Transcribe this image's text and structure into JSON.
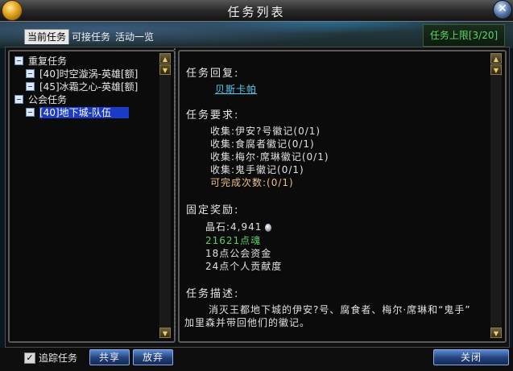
{
  "window": {
    "title": "任务列表",
    "close_glyph": "✕"
  },
  "tabs": [
    {
      "label": "当前任务",
      "active": true
    },
    {
      "label": "可接任务",
      "active": false
    },
    {
      "label": "活动一览",
      "active": false
    }
  ],
  "limit_badge": "任务上限[3/20]",
  "tree": {
    "categories": [
      {
        "label": "重复任务",
        "items": [
          "[40]时空漩涡-英雄[额]",
          "[45]冰霜之心-英雄[额]"
        ]
      },
      {
        "label": "公会任务",
        "items": [
          "[40]地下城-队伍"
        ]
      }
    ],
    "selected": "[40]地下城-队伍"
  },
  "detail": {
    "reply_header": "任务回复:",
    "reply_npc": "贝斯卡帕",
    "req_header": "任务要求:",
    "requirements": [
      "收集:伊安?号徽记(0/1)",
      "收集:食腐者徽记(0/1)",
      "收集:梅尔·席琳徽记(0/1)",
      "收集:鬼手徽记(0/1)"
    ],
    "completions": "可完成次数:(0/1)",
    "reward_header": "固定奖励:",
    "rewards": {
      "crystal": "晶石:4,941",
      "soul": "21621点魂",
      "guild_funds": "18点公会资金",
      "contribution": "24点个人贡献度"
    },
    "desc_header": "任务描述:",
    "description": [
      "消灭王都地下城的伊安?号、腐食者、梅尔·席琳和“鬼手”",
      "加里森并带回他们的徽记。"
    ]
  },
  "bottom": {
    "track_label": "追踪任务",
    "track_checked": true,
    "share_label": "共享",
    "abandon_label": "放弃",
    "close_label": "关闭"
  },
  "colors": {
    "link": "#58c8f0",
    "green": "#5ad06a",
    "highlight": "#1a3ac8"
  }
}
